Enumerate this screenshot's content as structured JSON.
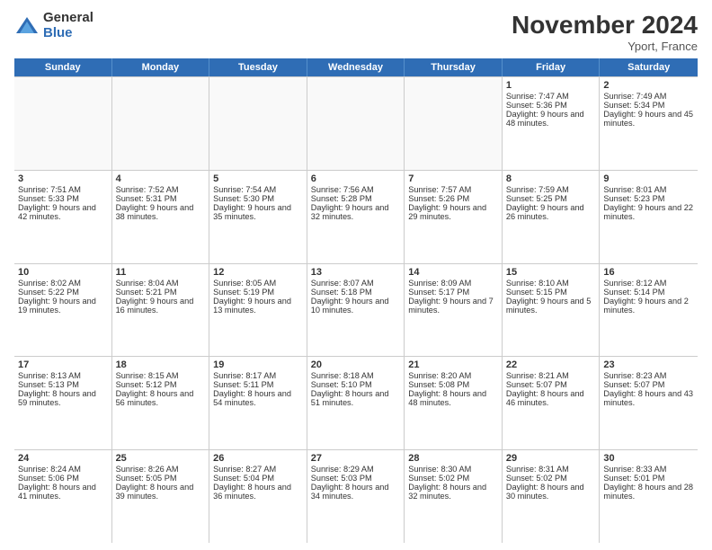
{
  "logo": {
    "general": "General",
    "blue": "Blue"
  },
  "title": "November 2024",
  "location": "Yport, France",
  "days": [
    "Sunday",
    "Monday",
    "Tuesday",
    "Wednesday",
    "Thursday",
    "Friday",
    "Saturday"
  ],
  "rows": [
    [
      {
        "day": "",
        "content": "",
        "empty": true
      },
      {
        "day": "",
        "content": "",
        "empty": true
      },
      {
        "day": "",
        "content": "",
        "empty": true
      },
      {
        "day": "",
        "content": "",
        "empty": true
      },
      {
        "day": "",
        "content": "",
        "empty": true
      },
      {
        "day": "1",
        "content": "Sunrise: 7:47 AM\nSunset: 5:36 PM\nDaylight: 9 hours and 48 minutes.",
        "empty": false
      },
      {
        "day": "2",
        "content": "Sunrise: 7:49 AM\nSunset: 5:34 PM\nDaylight: 9 hours and 45 minutes.",
        "empty": false
      }
    ],
    [
      {
        "day": "3",
        "content": "Sunrise: 7:51 AM\nSunset: 5:33 PM\nDaylight: 9 hours and 42 minutes.",
        "empty": false
      },
      {
        "day": "4",
        "content": "Sunrise: 7:52 AM\nSunset: 5:31 PM\nDaylight: 9 hours and 38 minutes.",
        "empty": false
      },
      {
        "day": "5",
        "content": "Sunrise: 7:54 AM\nSunset: 5:30 PM\nDaylight: 9 hours and 35 minutes.",
        "empty": false
      },
      {
        "day": "6",
        "content": "Sunrise: 7:56 AM\nSunset: 5:28 PM\nDaylight: 9 hours and 32 minutes.",
        "empty": false
      },
      {
        "day": "7",
        "content": "Sunrise: 7:57 AM\nSunset: 5:26 PM\nDaylight: 9 hours and 29 minutes.",
        "empty": false
      },
      {
        "day": "8",
        "content": "Sunrise: 7:59 AM\nSunset: 5:25 PM\nDaylight: 9 hours and 26 minutes.",
        "empty": false
      },
      {
        "day": "9",
        "content": "Sunrise: 8:01 AM\nSunset: 5:23 PM\nDaylight: 9 hours and 22 minutes.",
        "empty": false
      }
    ],
    [
      {
        "day": "10",
        "content": "Sunrise: 8:02 AM\nSunset: 5:22 PM\nDaylight: 9 hours and 19 minutes.",
        "empty": false
      },
      {
        "day": "11",
        "content": "Sunrise: 8:04 AM\nSunset: 5:21 PM\nDaylight: 9 hours and 16 minutes.",
        "empty": false
      },
      {
        "day": "12",
        "content": "Sunrise: 8:05 AM\nSunset: 5:19 PM\nDaylight: 9 hours and 13 minutes.",
        "empty": false
      },
      {
        "day": "13",
        "content": "Sunrise: 8:07 AM\nSunset: 5:18 PM\nDaylight: 9 hours and 10 minutes.",
        "empty": false
      },
      {
        "day": "14",
        "content": "Sunrise: 8:09 AM\nSunset: 5:17 PM\nDaylight: 9 hours and 7 minutes.",
        "empty": false
      },
      {
        "day": "15",
        "content": "Sunrise: 8:10 AM\nSunset: 5:15 PM\nDaylight: 9 hours and 5 minutes.",
        "empty": false
      },
      {
        "day": "16",
        "content": "Sunrise: 8:12 AM\nSunset: 5:14 PM\nDaylight: 9 hours and 2 minutes.",
        "empty": false
      }
    ],
    [
      {
        "day": "17",
        "content": "Sunrise: 8:13 AM\nSunset: 5:13 PM\nDaylight: 8 hours and 59 minutes.",
        "empty": false
      },
      {
        "day": "18",
        "content": "Sunrise: 8:15 AM\nSunset: 5:12 PM\nDaylight: 8 hours and 56 minutes.",
        "empty": false
      },
      {
        "day": "19",
        "content": "Sunrise: 8:17 AM\nSunset: 5:11 PM\nDaylight: 8 hours and 54 minutes.",
        "empty": false
      },
      {
        "day": "20",
        "content": "Sunrise: 8:18 AM\nSunset: 5:10 PM\nDaylight: 8 hours and 51 minutes.",
        "empty": false
      },
      {
        "day": "21",
        "content": "Sunrise: 8:20 AM\nSunset: 5:08 PM\nDaylight: 8 hours and 48 minutes.",
        "empty": false
      },
      {
        "day": "22",
        "content": "Sunrise: 8:21 AM\nSunset: 5:07 PM\nDaylight: 8 hours and 46 minutes.",
        "empty": false
      },
      {
        "day": "23",
        "content": "Sunrise: 8:23 AM\nSunset: 5:07 PM\nDaylight: 8 hours and 43 minutes.",
        "empty": false
      }
    ],
    [
      {
        "day": "24",
        "content": "Sunrise: 8:24 AM\nSunset: 5:06 PM\nDaylight: 8 hours and 41 minutes.",
        "empty": false
      },
      {
        "day": "25",
        "content": "Sunrise: 8:26 AM\nSunset: 5:05 PM\nDaylight: 8 hours and 39 minutes.",
        "empty": false
      },
      {
        "day": "26",
        "content": "Sunrise: 8:27 AM\nSunset: 5:04 PM\nDaylight: 8 hours and 36 minutes.",
        "empty": false
      },
      {
        "day": "27",
        "content": "Sunrise: 8:29 AM\nSunset: 5:03 PM\nDaylight: 8 hours and 34 minutes.",
        "empty": false
      },
      {
        "day": "28",
        "content": "Sunrise: 8:30 AM\nSunset: 5:02 PM\nDaylight: 8 hours and 32 minutes.",
        "empty": false
      },
      {
        "day": "29",
        "content": "Sunrise: 8:31 AM\nSunset: 5:02 PM\nDaylight: 8 hours and 30 minutes.",
        "empty": false
      },
      {
        "day": "30",
        "content": "Sunrise: 8:33 AM\nSunset: 5:01 PM\nDaylight: 8 hours and 28 minutes.",
        "empty": false
      }
    ]
  ]
}
